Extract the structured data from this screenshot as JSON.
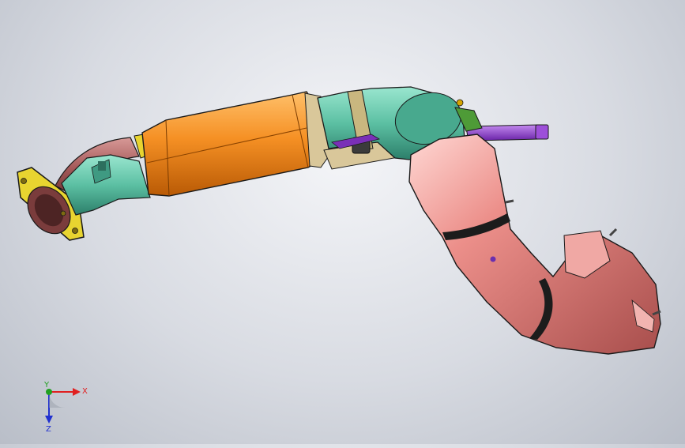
{
  "viewport": {
    "background_top": "#f4f5f8",
    "background_bottom": "#b9bec8"
  },
  "colors": {
    "flange": "#e8d430",
    "red_pipe": "#b56a6a",
    "teal": "#5fc2a6",
    "orange_body": "#f08a1a",
    "sand": "#d9c79a",
    "purple": "#8a3bc9",
    "pink_duct": "#e98a86",
    "band_black": "#1c1c1c",
    "green_bracket": "#4e9b37"
  },
  "triad": {
    "x_label": "X",
    "y_label": "Y",
    "z_label": "Z",
    "x_color": "#e02020",
    "y_color": "#20a020",
    "z_color": "#2030d0"
  }
}
